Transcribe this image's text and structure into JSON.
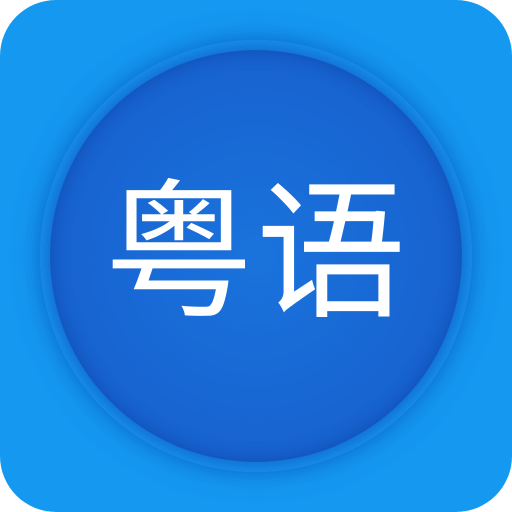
{
  "icon": {
    "label": "粤语",
    "colors": {
      "background": "#1598f0",
      "disc": "#1866d3",
      "text": "#ffffff"
    }
  }
}
